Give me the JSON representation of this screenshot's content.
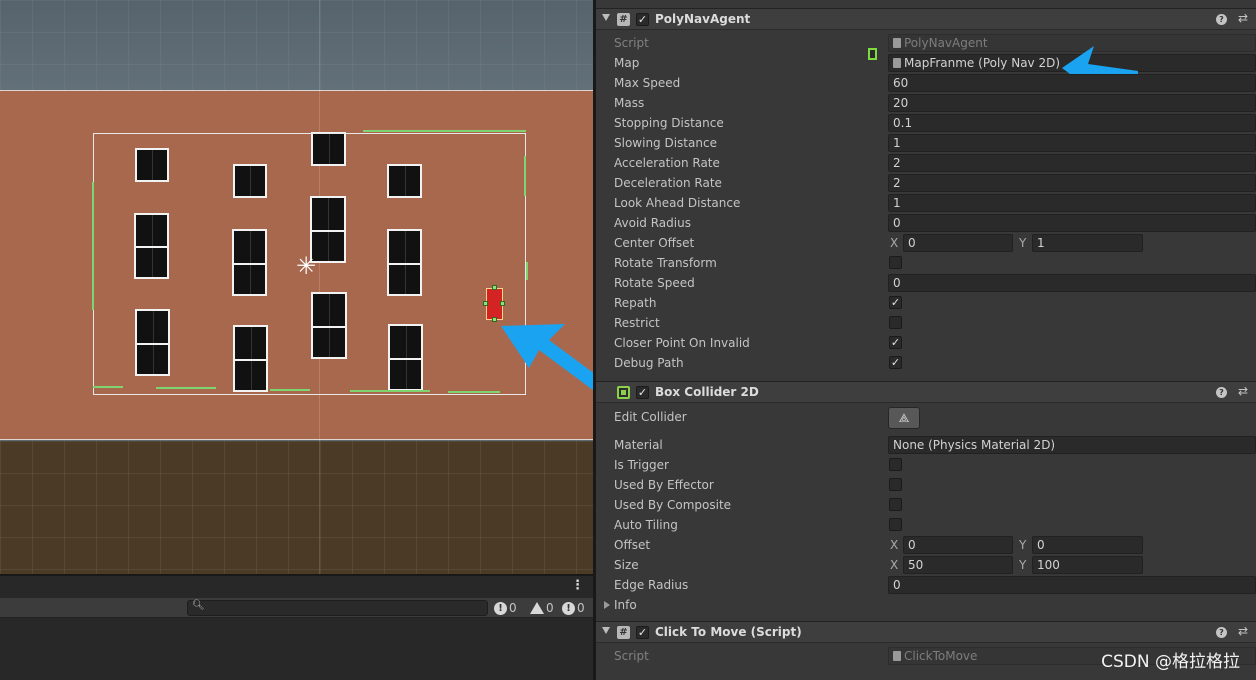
{
  "scene": {
    "windows": "building windows",
    "agent": "red agent"
  },
  "console": {
    "search_placeholder": "",
    "log_count": "0",
    "warning_count": "0",
    "error_count": "0",
    "menu_dots": "⋮"
  },
  "inspector": {
    "polynav": {
      "title": "PolyNavAgent",
      "enabled": true,
      "rows": [
        {
          "label": "Script",
          "value": "PolyNavAgent"
        },
        {
          "label": "Map",
          "value": "MapFranme (Poly Nav 2D)"
        },
        {
          "label": "Max Speed",
          "value": "60"
        },
        {
          "label": "Mass",
          "value": "20"
        },
        {
          "label": "Stopping Distance",
          "value": "0.1"
        },
        {
          "label": "Slowing Distance",
          "value": "1"
        },
        {
          "label": "Acceleration Rate",
          "value": "2"
        },
        {
          "label": "Deceleration Rate",
          "value": "2"
        },
        {
          "label": "Look Ahead Distance",
          "value": "1"
        },
        {
          "label": "Avoid Radius",
          "value": "0"
        },
        {
          "label": "Center Offset",
          "x": "0",
          "y": "1"
        },
        {
          "label": "Rotate Transform",
          "checked": false
        },
        {
          "label": "Rotate Speed",
          "value": "0"
        },
        {
          "label": "Repath",
          "checked": true
        },
        {
          "label": "Restrict",
          "checked": false
        },
        {
          "label": "Closer Point On Invalid",
          "checked": true
        },
        {
          "label": "Debug Path",
          "checked": true
        }
      ]
    },
    "boxcollider": {
      "title": "Box Collider 2D",
      "enabled": true,
      "rows": [
        {
          "label": "Edit Collider"
        },
        {
          "label": "Material",
          "value": "None (Physics Material 2D)"
        },
        {
          "label": "Is Trigger",
          "checked": false
        },
        {
          "label": "Used By Effector",
          "checked": false
        },
        {
          "label": "Used By Composite",
          "checked": false
        },
        {
          "label": "Auto Tiling",
          "checked": false
        },
        {
          "label": "Offset",
          "x": "0",
          "y": "0"
        },
        {
          "label": "Size",
          "x": "50",
          "y": "100"
        },
        {
          "label": "Edge Radius",
          "value": "0"
        },
        {
          "label": "Info"
        }
      ]
    },
    "clicktomove": {
      "title": "Click To Move (Script)",
      "enabled": true,
      "rows": [
        {
          "label": "Script",
          "value": "ClickToMove"
        }
      ]
    },
    "axis_x": "X",
    "axis_y": "Y"
  },
  "watermark": "CSDN @格拉格拉",
  "colors": {
    "arrow": "#1aa3f0",
    "building": "#a8684d",
    "agent": "#d42323",
    "collider_outline": "#7ed56f"
  },
  "icons": {
    "script": "hash-icon",
    "collider": "box-collider-icon",
    "help": "help-icon",
    "preset": "preset-icon",
    "checkmark": "check-icon"
  }
}
